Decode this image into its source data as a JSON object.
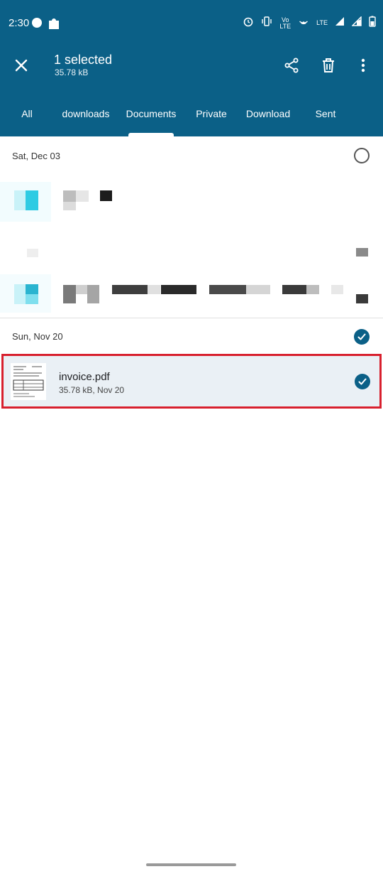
{
  "status_bar": {
    "time": "2:30",
    "network": "LTE"
  },
  "selection": {
    "title": "1 selected",
    "size": "35.78 kB"
  },
  "tabs": [
    "All",
    "downloads",
    "Documents",
    "Private",
    "Download",
    "Sent"
  ],
  "active_tab": "Documents",
  "groups": [
    {
      "date": "Sat, Dec 03",
      "selected": false
    },
    {
      "date": "Sun, Nov 20",
      "selected": true
    }
  ],
  "file": {
    "name": "invoice.pdf",
    "meta": "35.78 kB, Nov 20",
    "selected": true
  },
  "colors": {
    "appbar": "#0b6087",
    "highlight_border": "#d8202e",
    "selected_row": "#eaf0f5"
  }
}
